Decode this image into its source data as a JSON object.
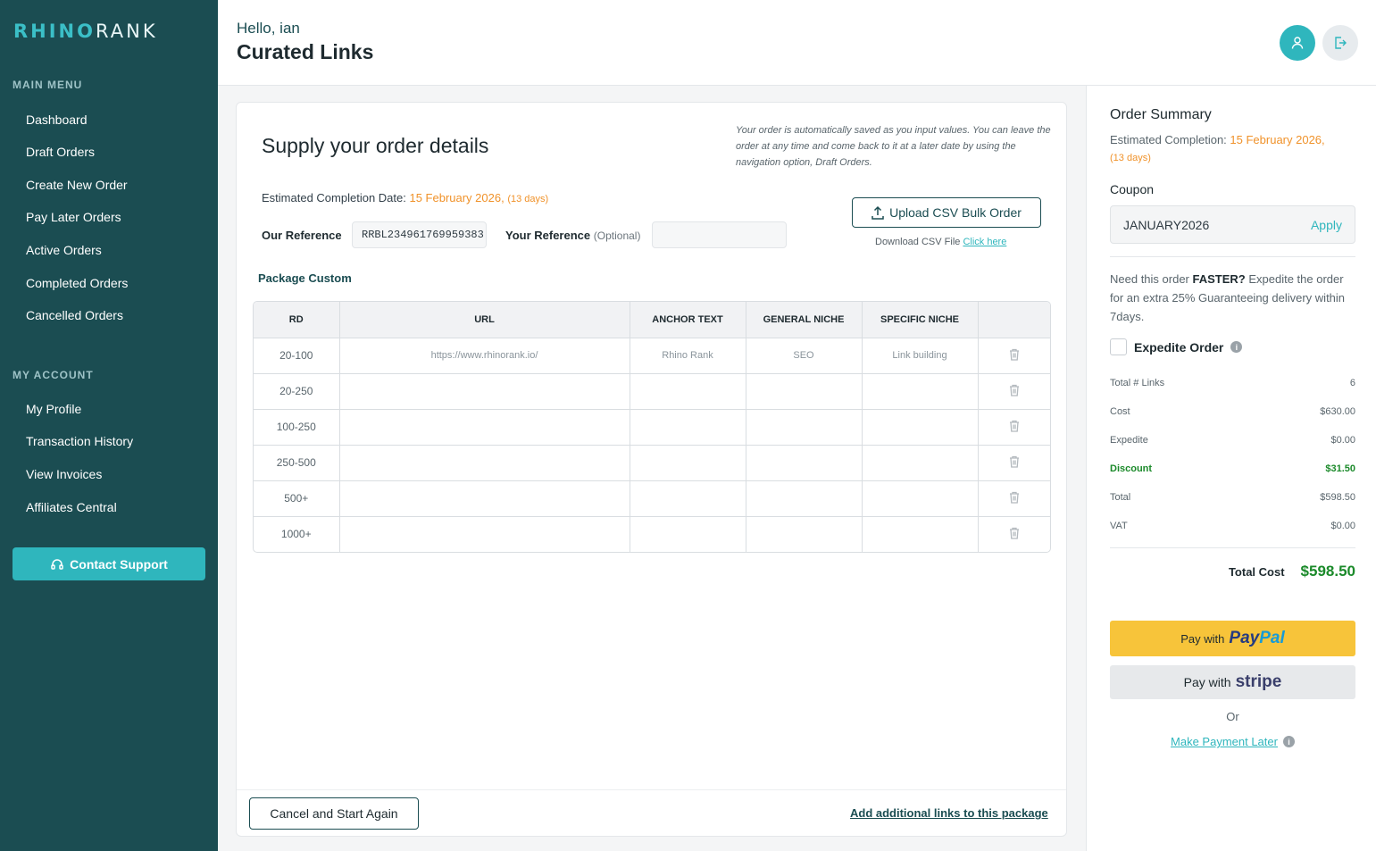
{
  "brand": {
    "logo_left": "RHINO",
    "logo_right": "RANK"
  },
  "sidebar": {
    "main_menu_heading": "MAIN MENU",
    "main_items": [
      {
        "label": "Dashboard"
      },
      {
        "label": "Draft Orders"
      },
      {
        "label": "Create New Order"
      },
      {
        "label": "Pay Later Orders"
      },
      {
        "label": "Active Orders"
      },
      {
        "label": "Completed Orders"
      },
      {
        "label": "Cancelled Orders"
      }
    ],
    "account_heading": "MY ACCOUNT",
    "account_items": [
      {
        "label": "My Profile"
      },
      {
        "label": "Transaction History"
      },
      {
        "label": "View Invoices"
      },
      {
        "label": "Affiliates Central"
      }
    ],
    "support_label": "Contact Support"
  },
  "header": {
    "greeting": "Hello, ian",
    "title": "Curated Links"
  },
  "order": {
    "title": "Supply your order details",
    "autosave_note": "Your order is automatically saved as you input values. You can leave the order at any time and come back to it at a later date by using the navigation option, Draft Orders.",
    "est_label": "Estimated Completion Date: ",
    "est_date": "15 February 2026,",
    "est_days": "(13 days)",
    "our_ref_label": "Our Reference",
    "our_ref_value": "RRBL234961769959383",
    "your_ref_label": "Your Reference",
    "your_ref_optional": "(Optional)",
    "your_ref_value": "",
    "upload_label": "Upload CSV Bulk Order",
    "download_text": "Download CSV File",
    "download_link": "Click here",
    "package_title": "Package Custom",
    "columns": [
      "RD",
      "URL",
      "ANCHOR TEXT",
      "GENERAL NICHE",
      "SPECIFIC NICHE"
    ],
    "rows": [
      {
        "rd": "20-100",
        "url": "https://www.rhinorank.io/",
        "anchor": "Rhino Rank",
        "general": "SEO",
        "specific": "Link building"
      },
      {
        "rd": "20-250",
        "url": "",
        "anchor": "",
        "general": "",
        "specific": ""
      },
      {
        "rd": "100-250",
        "url": "",
        "anchor": "",
        "general": "",
        "specific": ""
      },
      {
        "rd": "250-500",
        "url": "",
        "anchor": "",
        "general": "",
        "specific": ""
      },
      {
        "rd": "500+",
        "url": "",
        "anchor": "",
        "general": "",
        "specific": ""
      },
      {
        "rd": "1000+",
        "url": "",
        "anchor": "",
        "general": "",
        "specific": ""
      }
    ],
    "cancel_label": "Cancel and Start Again",
    "add_links_label": "Add additional links to this package"
  },
  "summary": {
    "title": "Order Summary",
    "est_label": "Estimated Completion: ",
    "est_date": "15 February 2026,",
    "est_days": "(13 days)",
    "coupon_label": "Coupon",
    "coupon_value": "JANUARY2026",
    "apply_label": "Apply",
    "faster_prefix": "Need this order ",
    "faster_bold": "FASTER?",
    "faster_suffix": " Expedite the order for an extra 25% Guaranteeing delivery within 7days.",
    "expedite_label": "Expedite Order",
    "lines": [
      {
        "label": "Total # Links",
        "value": "6"
      },
      {
        "label": "Cost",
        "value": "$630.00"
      },
      {
        "label": "Expedite",
        "value": "$0.00"
      },
      {
        "label": "Discount",
        "value": "$31.50"
      },
      {
        "label": "Total",
        "value": "$598.50"
      },
      {
        "label": "VAT",
        "value": "$0.00"
      }
    ],
    "total_cost_label": "Total Cost",
    "total_cost_value": "$598.50",
    "paypal_prefix": "Pay with",
    "paypal_brand_1": "Pay",
    "paypal_brand_2": "Pal",
    "stripe_prefix": "Pay with",
    "stripe_brand": "stripe",
    "or_text": "Or",
    "pay_later_label": "Make Payment Later"
  },
  "colors": {
    "sidebar": "#1b4d52",
    "accent": "#2fb6bd",
    "orange": "#f0922a",
    "green": "#1b8a2a",
    "paypal": "#f7c43a"
  }
}
